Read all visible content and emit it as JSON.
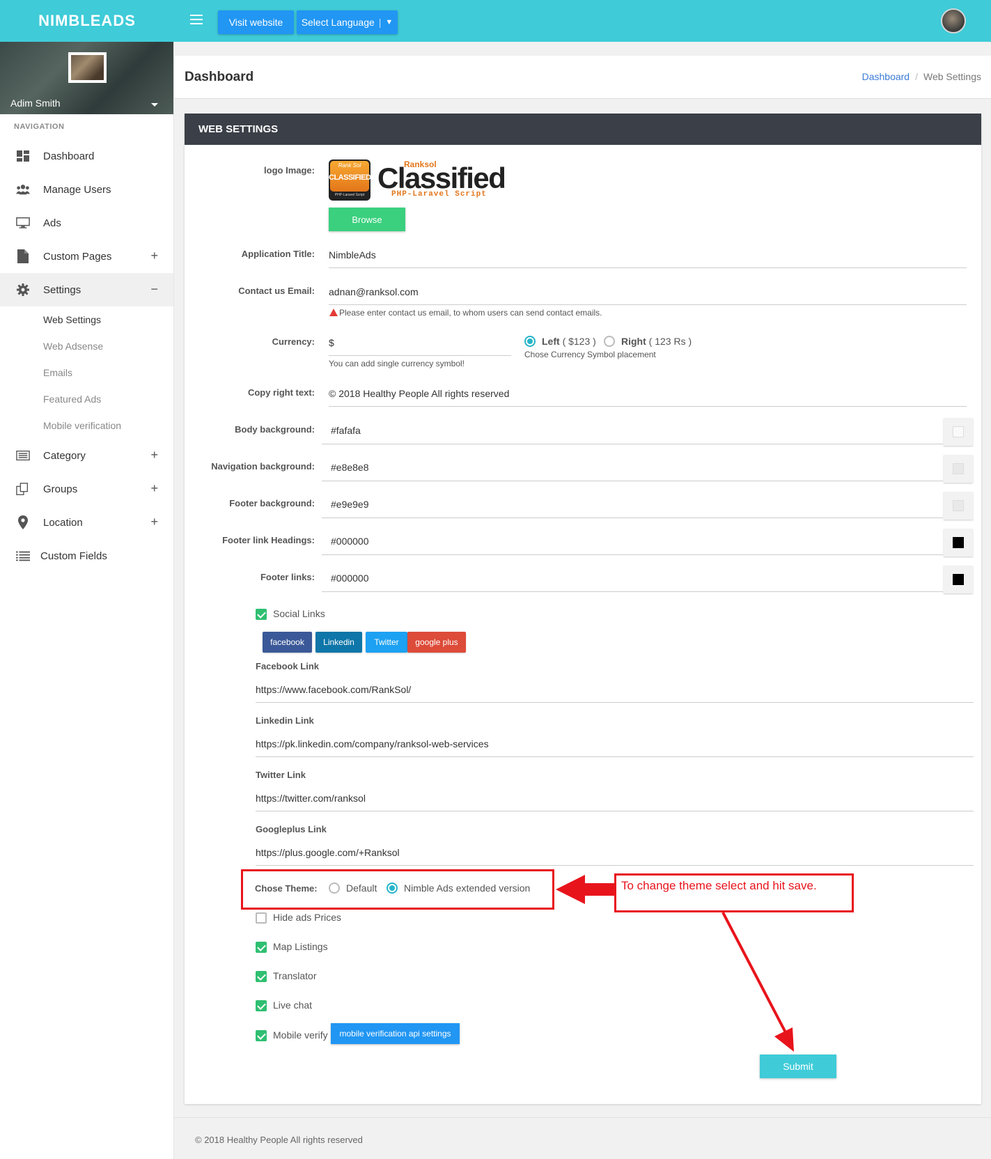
{
  "brand": "NIMBLEADS",
  "topbar": {
    "visit_website": "Visit website",
    "select_language": "Select Language",
    "lang_caret": "▼"
  },
  "user": {
    "name": "Adim Smith"
  },
  "nav": {
    "header": "NAVIGATION",
    "items": [
      {
        "label": "Dashboard",
        "icon": "dashboard-icon"
      },
      {
        "label": "Manage Users",
        "icon": "users-icon"
      },
      {
        "label": "Ads",
        "icon": "monitor-icon"
      },
      {
        "label": "Custom Pages",
        "icon": "file-icon",
        "toggle": "+"
      },
      {
        "label": "Settings",
        "icon": "gear-icon",
        "toggle": "−"
      },
      {
        "label": "Category",
        "icon": "list-icon",
        "toggle": "+"
      },
      {
        "label": "Groups",
        "icon": "groups-icon",
        "toggle": "+"
      },
      {
        "label": "Location",
        "icon": "pin-icon",
        "toggle": "+"
      },
      {
        "label": "Custom Fields",
        "icon": "fields-icon"
      }
    ],
    "settings_sub": [
      "Web Settings",
      "Web Adsense",
      "Emails",
      "Featured Ads",
      "Mobile verification"
    ]
  },
  "page": {
    "title": "Dashboard",
    "breadcrumb": [
      "Dashboard",
      "Web Settings"
    ]
  },
  "card": {
    "title": "WEB SETTINGS"
  },
  "form": {
    "logo_label": "logo Image:",
    "logo": {
      "brand_top": "Ranksol",
      "brand_main": "Classified",
      "brand_sub": "PHP-Laravel Script",
      "badge_top": "Rank Sol",
      "badge_main": "CLASSIFIED",
      "badge_sub": "PHP-Laravel Script"
    },
    "browse": "Browse",
    "app_title_label": "Application Title:",
    "app_title": "NimbleAds",
    "email_label": "Contact us Email:",
    "email": "adnan@ranksol.com",
    "email_hint": "Please enter contact us email, to whom users can send contact emails.",
    "currency_label": "Currency:",
    "currency": "$",
    "currency_hint": "You can add single currency symbol!",
    "placement_left": "Left",
    "placement_left_ex": "( $123 )",
    "placement_right": "Right",
    "placement_right_ex": "( 123 Rs )",
    "placement_hint": "Chose Currency Symbol placement",
    "copyright_label": "Copy right text:",
    "copyright": "© 2018 Healthy People All  rights reserved",
    "colors": [
      {
        "label": "Body background:",
        "value": "#fafafa"
      },
      {
        "label": "Navigation background:",
        "value": "#e8e8e8"
      },
      {
        "label": "Footer background:",
        "value": "#e9e9e9"
      },
      {
        "label": "Footer link Headings:",
        "value": "#000000"
      },
      {
        "label": "Footer links:",
        "value": "#000000"
      }
    ],
    "social_links_label": "Social Links",
    "social_buttons": [
      {
        "label": "facebook",
        "color": "#3b5998"
      },
      {
        "label": "Linkedin",
        "color": "#0e76a8"
      },
      {
        "label": "Twitter",
        "color": "#1da1f2"
      },
      {
        "label": "google plus",
        "color": "#dd4b39"
      }
    ],
    "facebook_label": "Facebook Link",
    "facebook": "https://www.facebook.com/RankSol/",
    "linkedin_label": "Linkedin Link",
    "linkedin": "https://pk.linkedin.com/company/ranksol-web-services",
    "twitter_label": "Twitter Link",
    "twitter": "https://twitter.com/ranksol",
    "googleplus_label": "Googleplus Link",
    "googleplus": "https://plus.google.com/+Ranksol",
    "theme_label": "Chose Theme:",
    "theme_default": "Default",
    "theme_extended": "Nimble Ads extended version",
    "annotation": "To change theme select and hit save.",
    "checks": [
      {
        "label": "Hide ads Prices",
        "checked": false
      },
      {
        "label": "Map Listings",
        "checked": true
      },
      {
        "label": "Translator",
        "checked": true
      },
      {
        "label": "Live chat",
        "checked": true
      },
      {
        "label": "Mobile verify",
        "checked": true
      }
    ],
    "mobile_api_button": "mobile verification api settings",
    "submit": "Submit"
  },
  "footer": "© 2018 Healthy People All  rights reserved"
}
